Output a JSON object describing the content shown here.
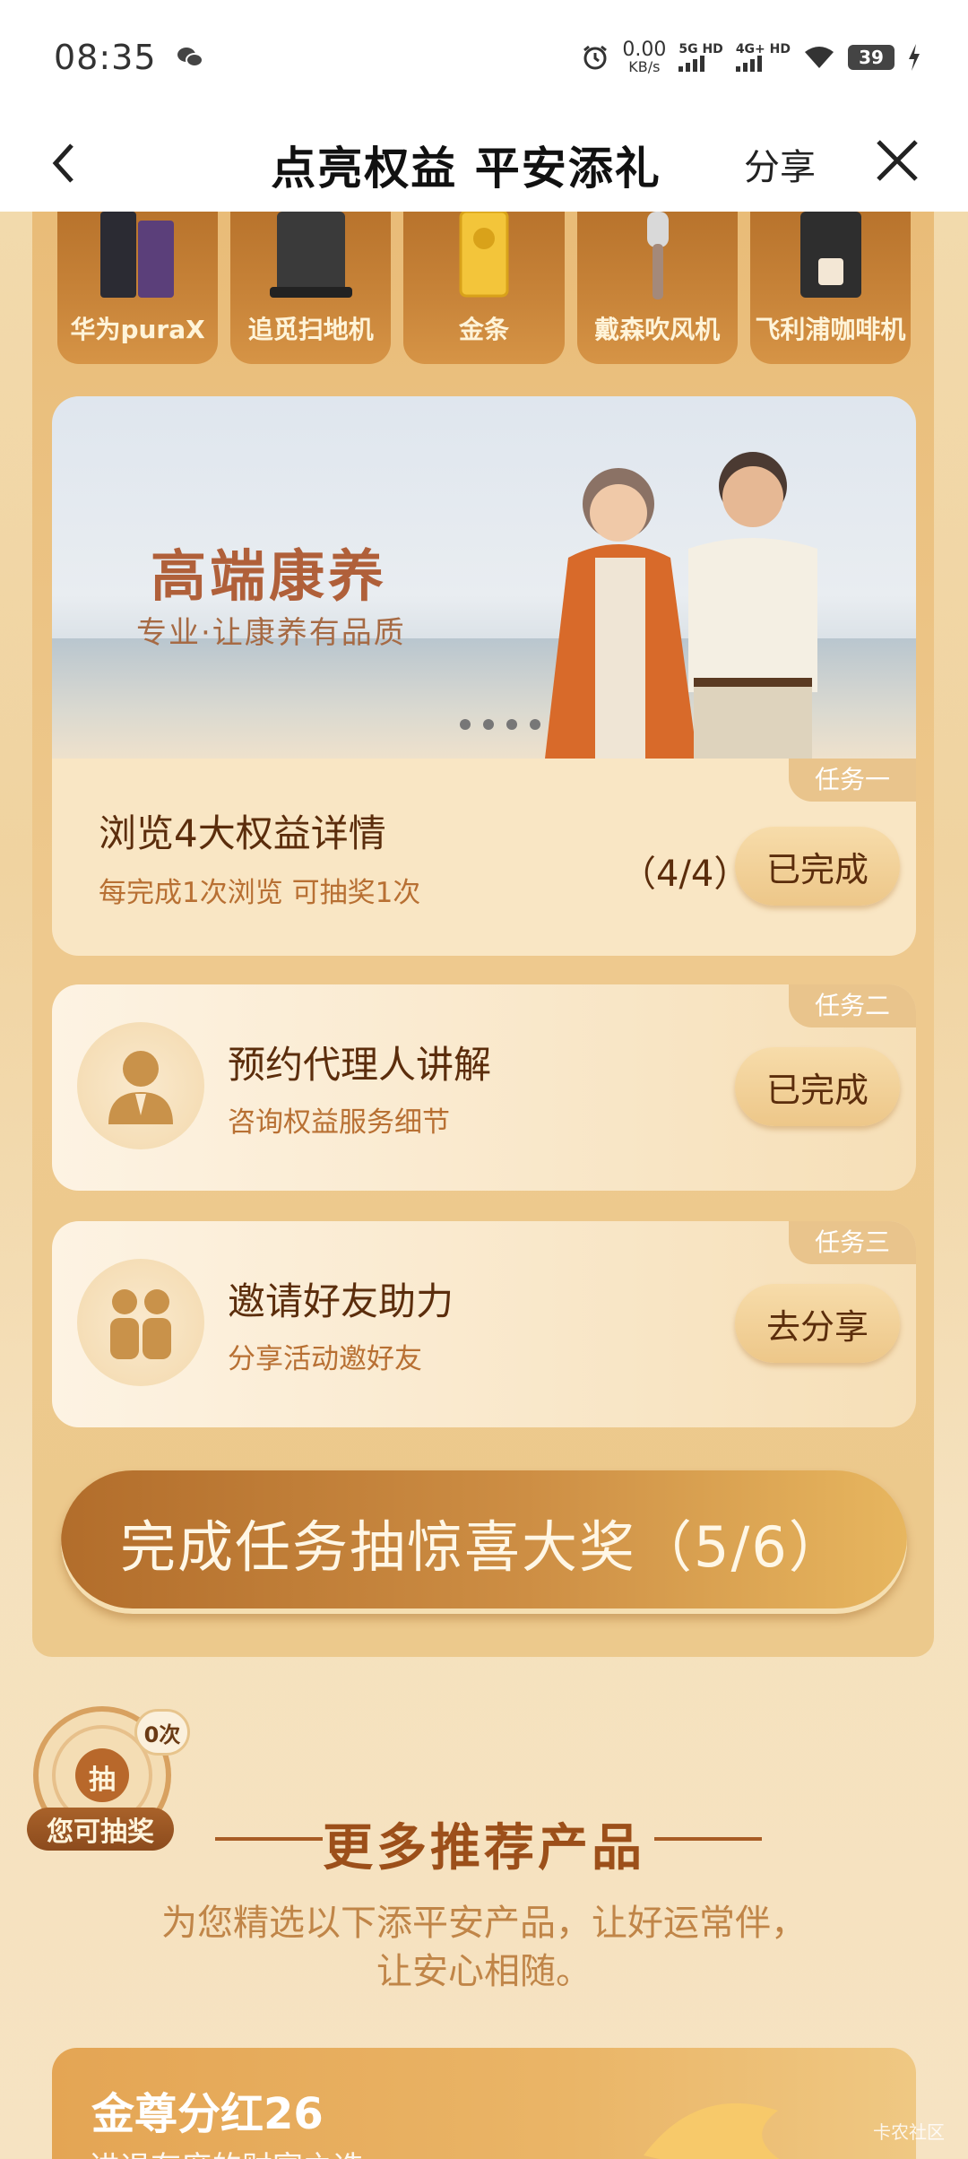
{
  "status_bar": {
    "time": "08:35",
    "net_speed_value": "0.00",
    "net_speed_unit": "KB/s",
    "sim1_label": "5G HD",
    "sim2_label": "4G+ HD",
    "battery": "39"
  },
  "nav": {
    "title": "点亮权益 平安添礼",
    "share_label": "分享"
  },
  "prizes": [
    {
      "name": "华为puraX"
    },
    {
      "name": "追觅扫地机"
    },
    {
      "name": "金条"
    },
    {
      "name": "戴森吹风机"
    },
    {
      "name": "飞利浦咖啡机"
    }
  ],
  "banner": {
    "headline": "高端康养",
    "subtitle": "专业·让康养有品质"
  },
  "tasks": [
    {
      "tag": "任务一",
      "title": "浏览4大权益详情",
      "subtitle": "每完成1次浏览 可抽奖1次",
      "progress": "（4/4）",
      "button": "已完成"
    },
    {
      "tag": "任务二",
      "title": "预约代理人讲解",
      "subtitle": "咨询权益服务细节",
      "button": "已完成"
    },
    {
      "tag": "任务三",
      "title": "邀请好友助力",
      "subtitle": "分享活动邀好友",
      "button": "去分享"
    }
  ],
  "draw_button": "完成任务抽惊喜大奖（5/6）",
  "lottery": {
    "char": "抽",
    "count": "0次",
    "label": "您可抽奖"
  },
  "more": {
    "title": "更多推荐产品",
    "subtitle_line1": "为您精选以下添平安产品，让好运常伴，",
    "subtitle_line2": "让安心相随。"
  },
  "product": {
    "title": "金尊分红26",
    "subtitle": "进退有度的财富之选"
  },
  "watermark": "卡农社区",
  "colors": {
    "accent": "#c9853a",
    "title_brown": "#5b2d0c",
    "subtitle_orange": "#b87033"
  }
}
